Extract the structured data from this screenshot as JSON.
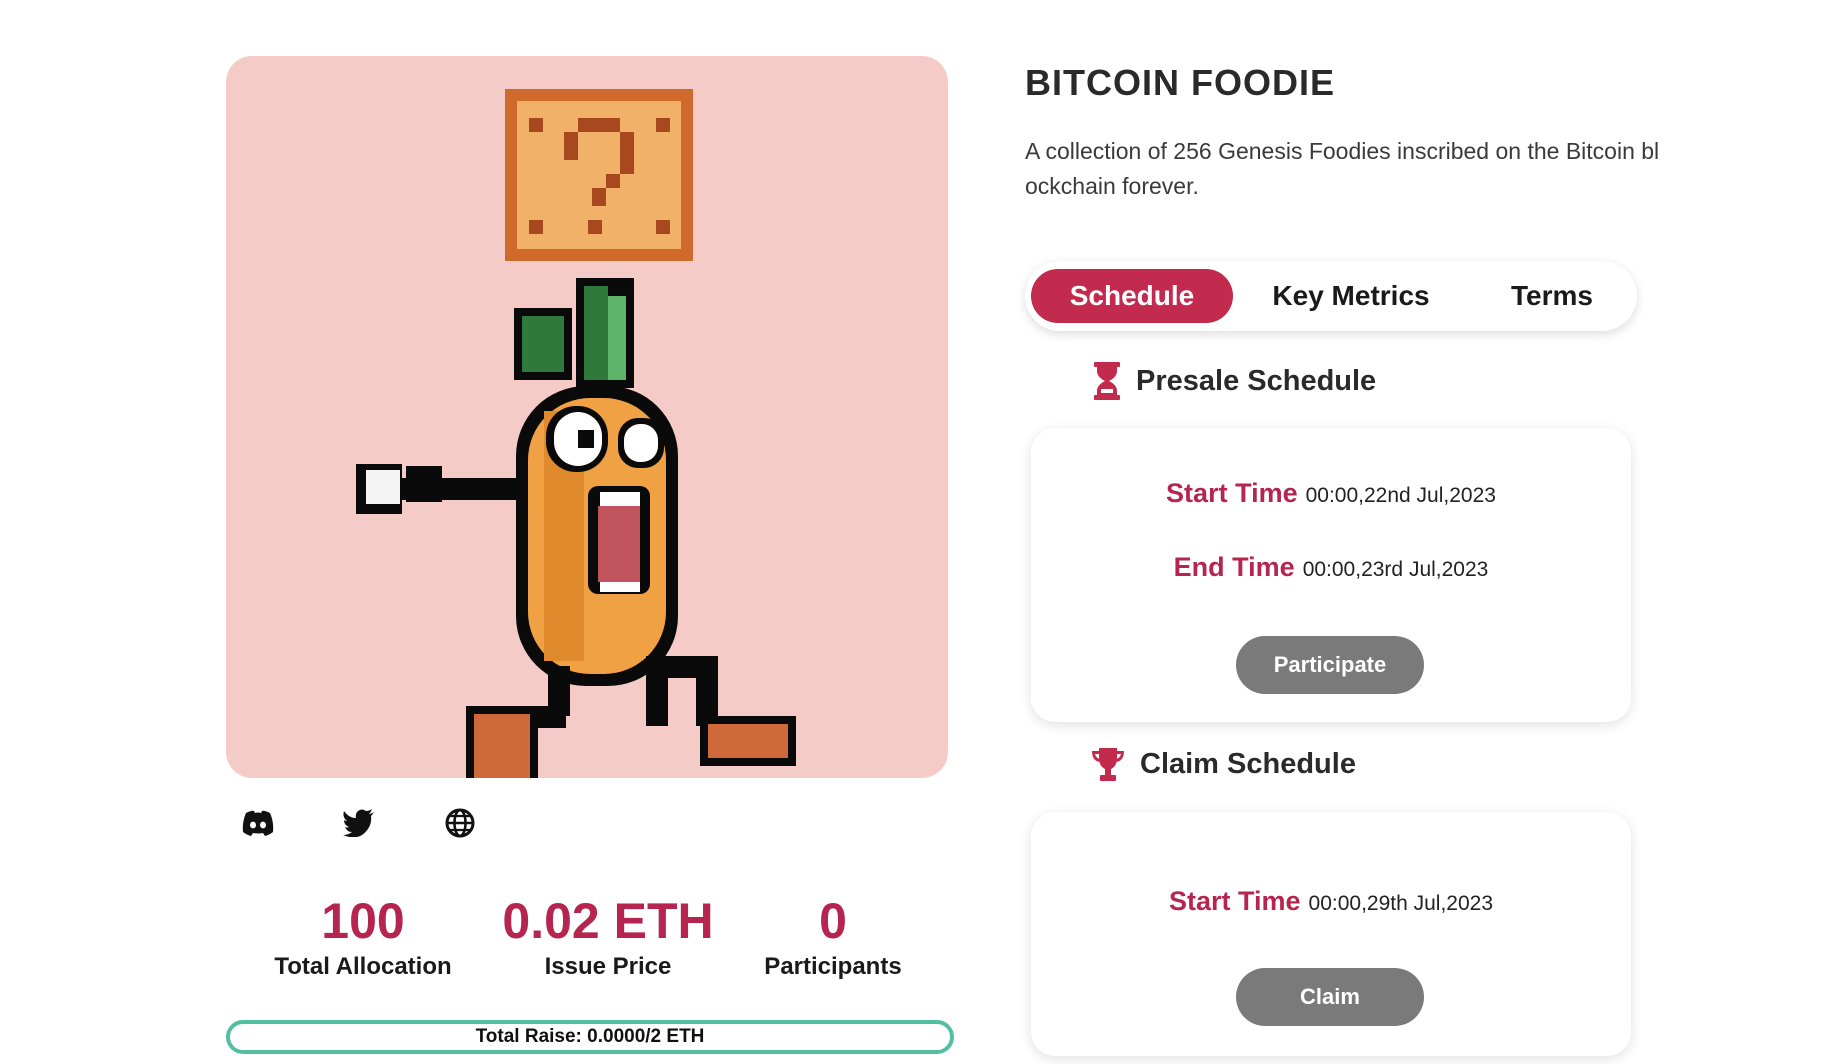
{
  "nft": {
    "title": "BITCOIN FOODIE",
    "description": "A collection of 256 Genesis Foodies inscribed on the Bitcoin blockchain forever.",
    "art_icon": "pixel-carrot-mystery-box-image"
  },
  "socials": [
    {
      "icon": "discord-icon"
    },
    {
      "icon": "twitter-icon"
    },
    {
      "icon": "globe-icon"
    }
  ],
  "stats": {
    "allocation": {
      "value": "100",
      "label": "Total Allocation"
    },
    "price": {
      "value": "0.02 ETH",
      "label": "Issue Price"
    },
    "participants": {
      "value": "0",
      "label": "Participants"
    }
  },
  "raise": {
    "text": "Total Raise: 0.0000/2 ETH",
    "progress": 0
  },
  "tabs": {
    "schedule": "Schedule",
    "metrics": "Key Metrics",
    "terms": "Terms",
    "active": "Schedule"
  },
  "presale": {
    "heading": "Presale Schedule",
    "start_label": "Start Time",
    "start_value": "00:00,22nd Jul,2023",
    "end_label": "End Time",
    "end_value": "00:00,23rd Jul,2023",
    "button": "Participate"
  },
  "claim": {
    "heading": "Claim Schedule",
    "start_label": "Start Time",
    "start_value": "00:00,29th Jul,2023",
    "button": "Claim"
  },
  "colors": {
    "accent": "#c22a4e",
    "value_red": "#b5254f",
    "art_bg": "#f5cbc7",
    "progress_border": "#52c0a0",
    "button_gray": "#7a7a7a"
  }
}
